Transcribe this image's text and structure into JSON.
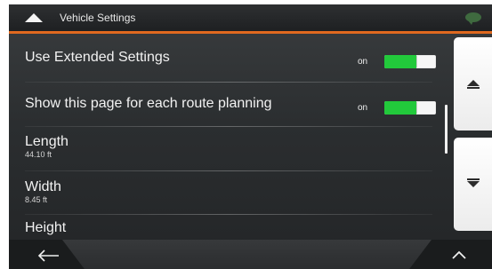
{
  "header": {
    "title": "Vehicle Settings"
  },
  "settings": [
    {
      "label": "Use Extended Settings",
      "state": "on"
    },
    {
      "label": "Show this page for each route planning",
      "state": "on"
    }
  ],
  "dimensions": [
    {
      "label": "Length",
      "value": "44.10 ft"
    },
    {
      "label": "Width",
      "value": "8.45 ft"
    },
    {
      "label": "Height"
    }
  ],
  "colors": {
    "accent": "#e0691f",
    "toggle_on": "#22c93b",
    "background": "#2b2e30"
  },
  "icons": {
    "top_left": "triangle-up",
    "top_right": "chat-bubble",
    "bottom_left": "arrow-left",
    "bottom_right": "chevron-up",
    "scroll_up": "triangle-up-with-bar",
    "scroll_down": "triangle-down-with-bar"
  }
}
